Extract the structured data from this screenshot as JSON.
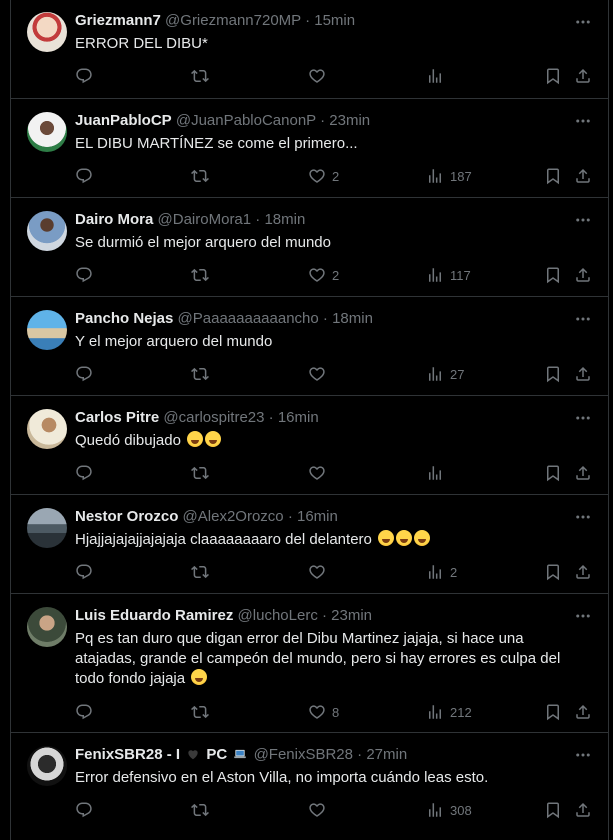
{
  "tweets": [
    {
      "name": "Griezmann7",
      "handle": "@Griezmann720MP",
      "time": "15min",
      "text": "ERROR DEL DIBU*",
      "replies": "",
      "retweets": "",
      "likes": "",
      "views": ""
    },
    {
      "name": "JuanPabloCP",
      "handle": "@JuanPabloCanonP",
      "time": "23min",
      "text": "EL DIBU MARTÍNEZ  se come el primero...",
      "replies": "",
      "retweets": "",
      "likes": "2",
      "views": "187"
    },
    {
      "name": "Dairo Mora",
      "handle": "@DairoMora1",
      "time": "18min",
      "text": "Se durmió el mejor arquero del mundo",
      "replies": "",
      "retweets": "",
      "likes": "2",
      "views": "117"
    },
    {
      "name": "Pancho Nejas",
      "handle": "@Paaaaaaaaaancho",
      "time": "18min",
      "text": "Y el mejor arquero del mundo",
      "replies": "",
      "retweets": "",
      "likes": "",
      "views": "27"
    },
    {
      "name": "Carlos Pitre",
      "handle": "@carlospitre23",
      "time": "16min",
      "text": "Quedó dibujado",
      "emoji_count": 2,
      "replies": "",
      "retweets": "",
      "likes": "",
      "views": ""
    },
    {
      "name": "Nestor Orozco",
      "handle": "@Alex2Orozco",
      "time": "16min",
      "text": "Hjajjajajajjajajaja claaaaaaaaro del delantero",
      "emoji_count": 3,
      "replies": "",
      "retweets": "",
      "likes": "",
      "views": "2"
    },
    {
      "name": "Luis Eduardo Ramirez",
      "handle": "@luchoLerc",
      "time": "23min",
      "text": "Pq es tan duro que digan error del Dibu Martinez jajaja, si hace una atajadas, grande el campeón del mundo, pero si hay errores es culpa del todo fondo jajaja",
      "emoji_count": 1,
      "replies": "",
      "retweets": "",
      "likes": "8",
      "views": "212"
    },
    {
      "name_prefix": "FenixSBR28 - I",
      "name_suffix": "PC",
      "handle": "@FenixSBR28",
      "time": "27min",
      "text": "Error defensivo en el Aston Villa, no importa cuándo leas esto.",
      "replies": "",
      "retweets": "",
      "likes": "",
      "views": "308"
    }
  ],
  "ui": {
    "separator": "·",
    "icons": [
      "reply-icon",
      "retweet-icon",
      "like-icon",
      "views-icon",
      "bookmark-icon",
      "share-icon",
      "more-icon",
      "heart-emoji-icon",
      "laptop-emoji-icon",
      "laughing-emoji-icon"
    ]
  },
  "colors": {
    "background": "#000000",
    "text": "#e7e9ea",
    "muted": "#71767b",
    "border": "#2f3336"
  }
}
